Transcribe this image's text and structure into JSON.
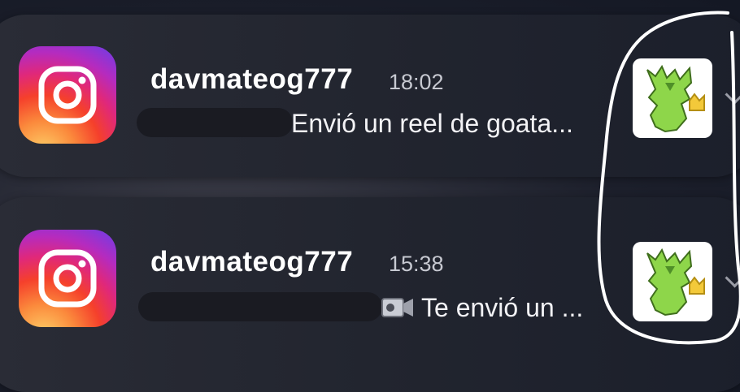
{
  "notifications": [
    {
      "app": "Instagram",
      "username": "davmateog777",
      "time": "18:02",
      "message": "Envió un reel de goata..."
    },
    {
      "app": "Instagram",
      "username": "davmateog777",
      "time": "15:38",
      "message": "Te envió un ..."
    }
  ],
  "colors": {
    "background": "#1c1f2b",
    "card": "#262933",
    "annotation": "#ffffff"
  },
  "icons": [
    "instagram-icon",
    "video-camera-icon",
    "chevron-icon"
  ]
}
